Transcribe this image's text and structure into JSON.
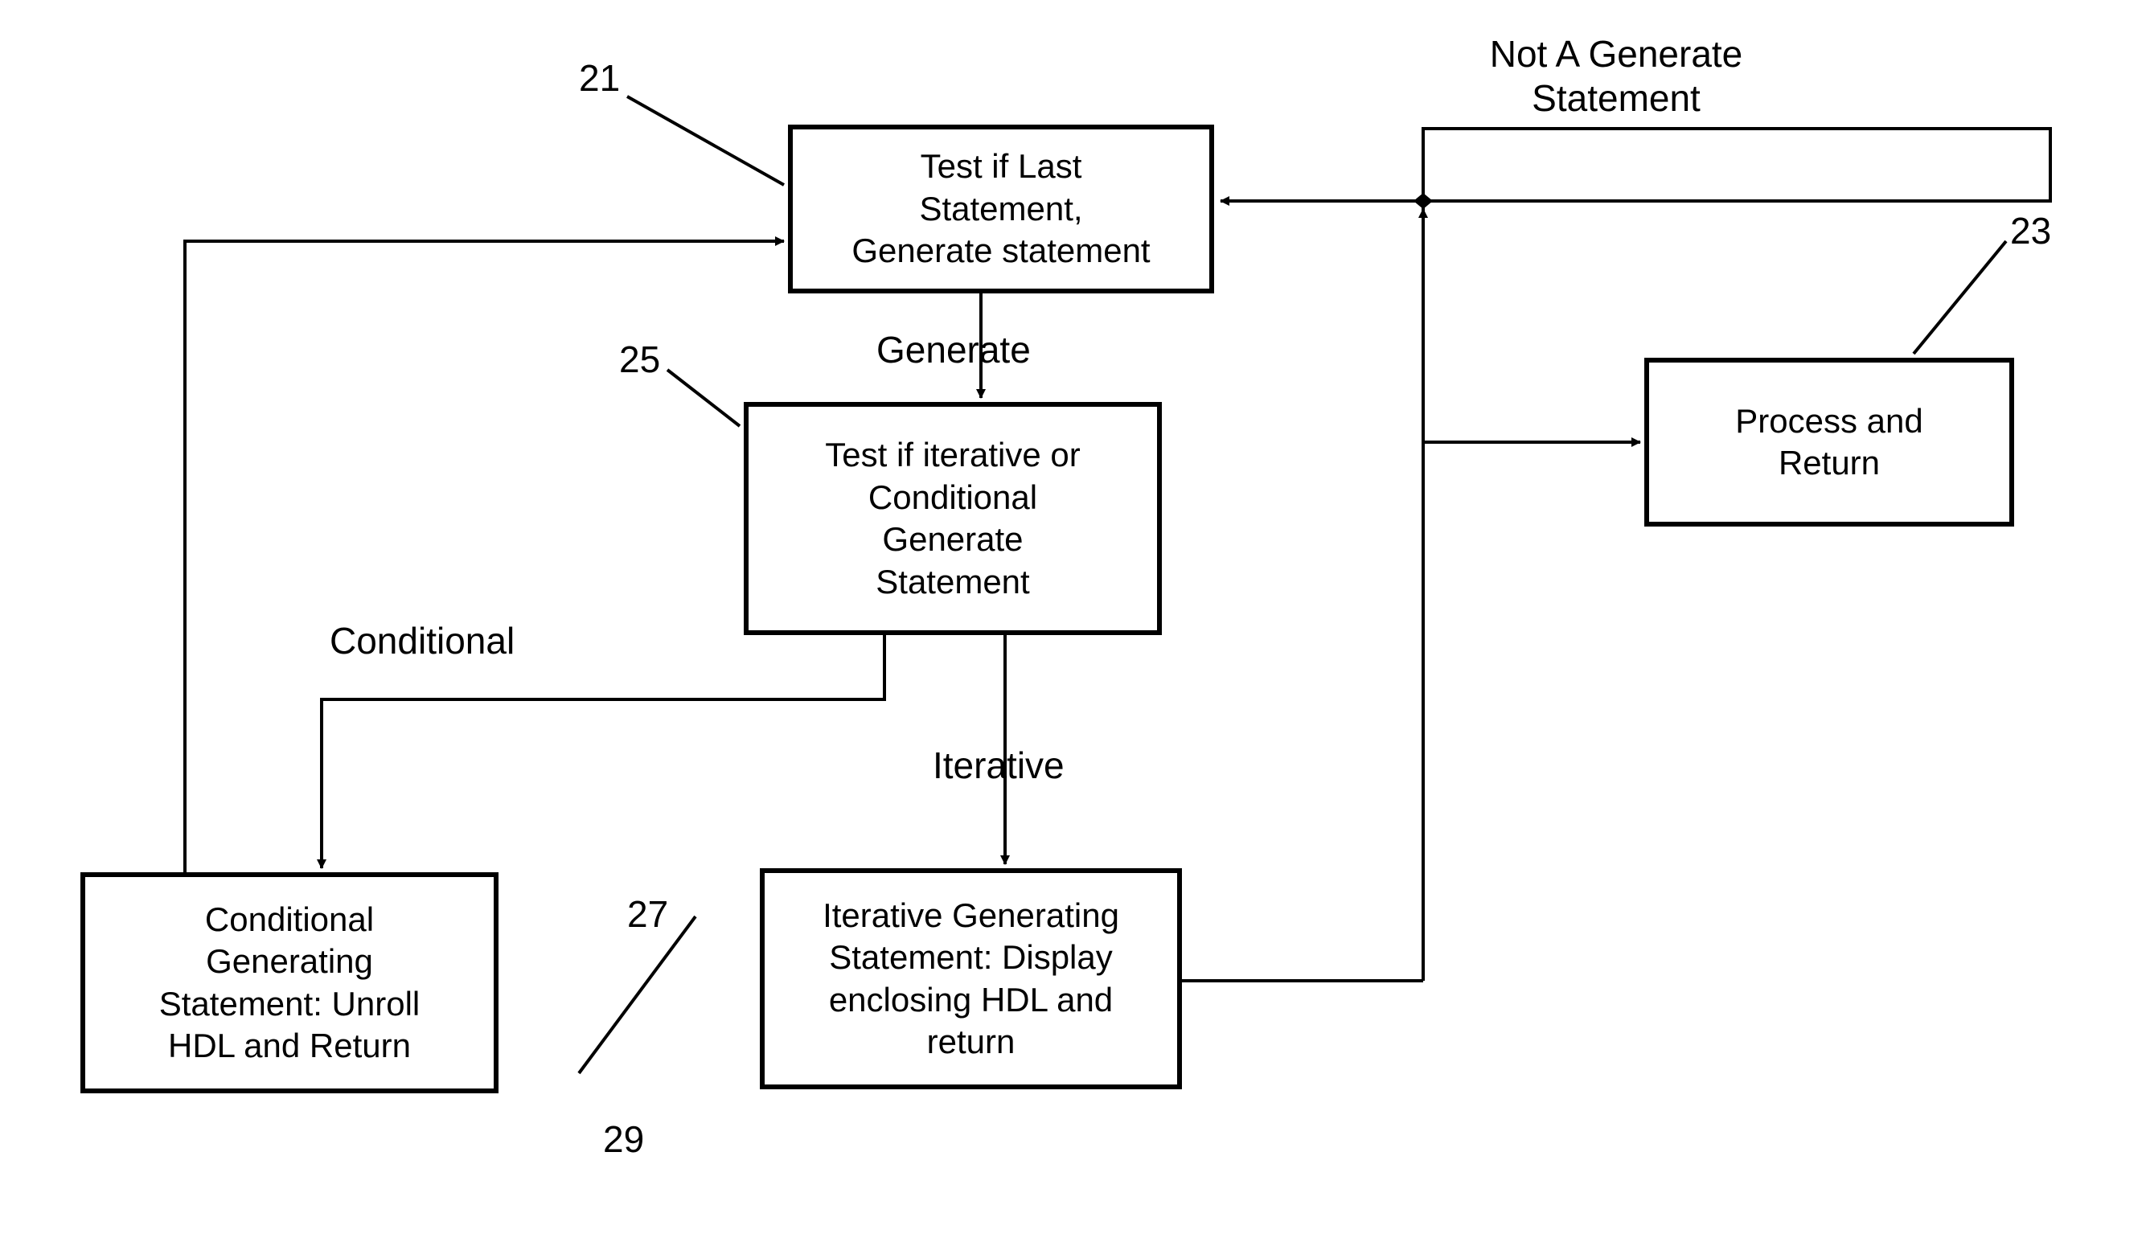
{
  "labels": {
    "n21": "21",
    "n23": "23",
    "n25": "25",
    "n27": "27",
    "n29": "29",
    "not_generate": "Not A Generate\nStatement",
    "generate": "Generate",
    "conditional": "Conditional",
    "iterative": "Iterative"
  },
  "boxes": {
    "b21": "Test if Last\nStatement,\nGenerate statement",
    "b23": "Process and\nReturn",
    "b25": "Test if iterative or\nConditional\nGenerate\nStatement",
    "b27": "Iterative Generating\nStatement: Display\nenclosing HDL and\nreturn",
    "b29": "Conditional\nGenerating\nStatement: Unroll\nHDL and Return"
  }
}
